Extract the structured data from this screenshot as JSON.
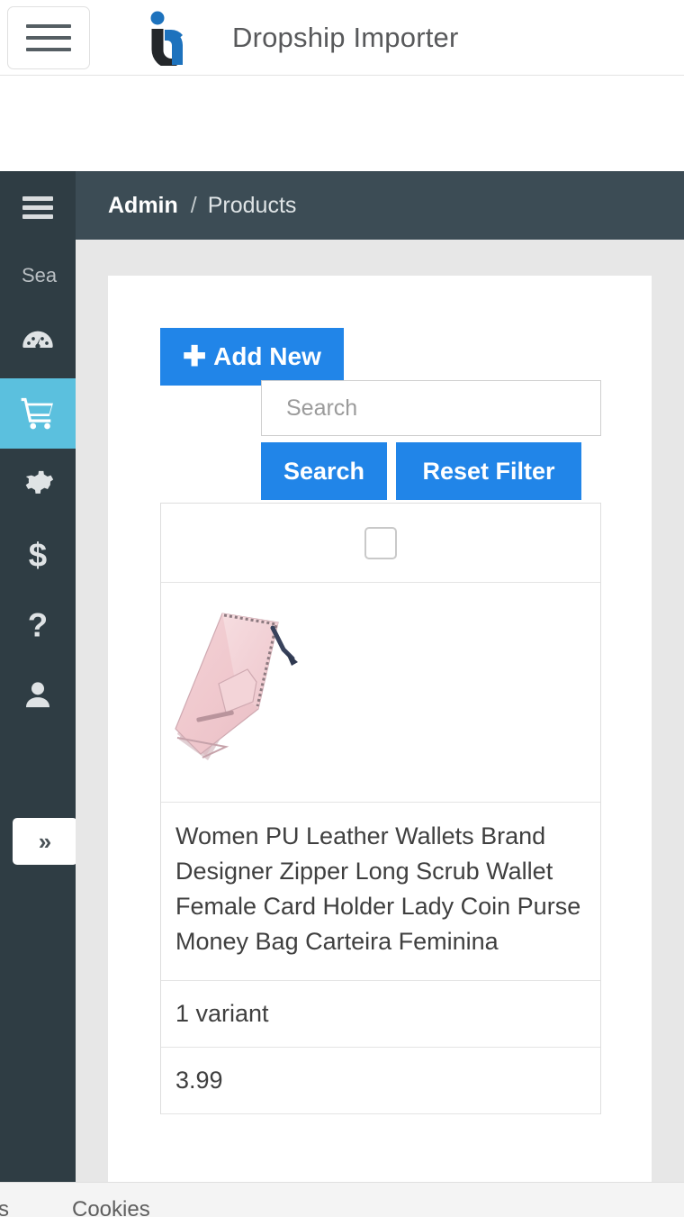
{
  "header": {
    "menu_icon": "hamburger-icon",
    "logo_icon": "ia-brand-logo",
    "title": "Dropship Importer"
  },
  "sidebar": {
    "toggle_icon": "hamburger-icon",
    "search_label": "Sea",
    "search_label_full": "Search",
    "expand_label": "»",
    "items": [
      {
        "icon": "dashboard-gauge-icon",
        "label": "Dashboard",
        "active": false
      },
      {
        "icon": "shopping-cart-icon",
        "label": "Products",
        "active": true
      },
      {
        "icon": "gear-icon",
        "label": "Settings",
        "active": false
      },
      {
        "icon": "dollar-icon",
        "label": "Billing",
        "active": false
      },
      {
        "icon": "question-mark-icon",
        "label": "Help",
        "active": false
      },
      {
        "icon": "user-icon",
        "label": "Account",
        "active": false
      }
    ]
  },
  "breadcrumb": {
    "root": "Admin",
    "separator": "/",
    "current": "Products"
  },
  "toolbar": {
    "add_new_label": "Add New",
    "add_new_icon": "plus-icon",
    "search_placeholder": "Search",
    "search_value": "",
    "search_button_label": "Search",
    "reset_button_label": "Reset Filter"
  },
  "products_table": {
    "select_all_checked": false,
    "rows": [
      {
        "image_alt": "pink-leather-wallet",
        "title": "Women PU Leather Wallets Brand Designer Zipper Long Scrub Wallet Female Card Holder Lady Coin Purse Money Bag Carteira Feminina",
        "variants": "1 variant",
        "price": "3.99"
      }
    ]
  },
  "footer": {
    "credits_label": "its",
    "cookies_label": "Cookies"
  },
  "colors": {
    "accent_blue": "#2185e8",
    "sidebar_bg": "#2f3d44",
    "sidebar_active": "#5bc0de",
    "breadcrumb_bg": "#3c4c55",
    "page_bg": "#e7e7e7",
    "logo_blue": "#1d72bd",
    "logo_dark": "#24272a"
  }
}
